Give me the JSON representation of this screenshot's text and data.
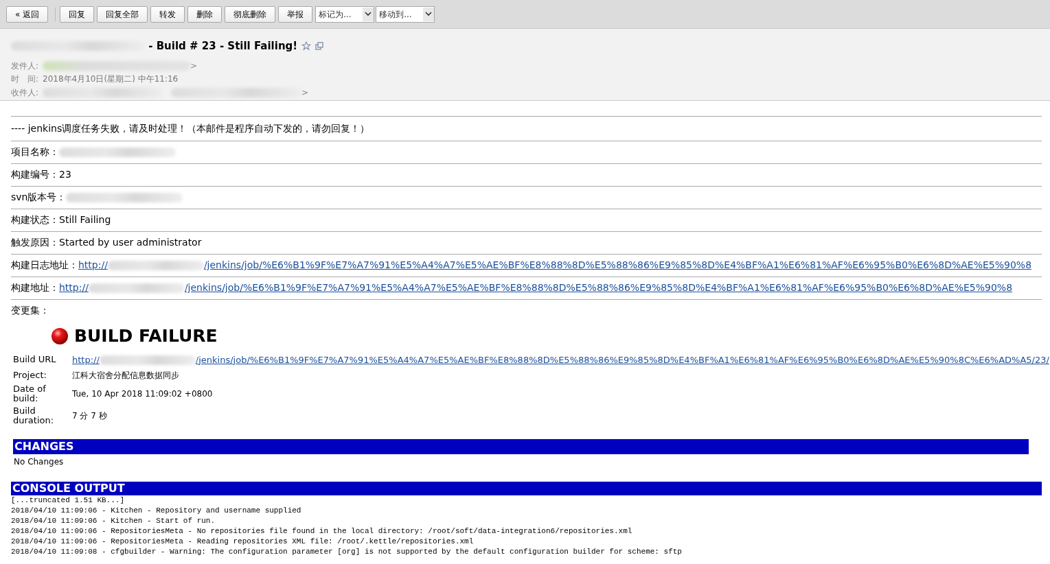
{
  "toolbar": [
    {
      "kind": "button",
      "label": "« 返回"
    },
    {
      "kind": "separator"
    },
    {
      "kind": "button",
      "label": "回复"
    },
    {
      "kind": "button",
      "label": "回复全部"
    },
    {
      "kind": "button",
      "label": "转发"
    },
    {
      "kind": "button",
      "label": "删除"
    },
    {
      "kind": "button",
      "label": "彻底删除"
    },
    {
      "kind": "button",
      "label": "举报"
    },
    {
      "kind": "select",
      "label": "标记为..."
    },
    {
      "kind": "select",
      "label": "移动到..."
    }
  ],
  "header": {
    "subject": " - Build # 23 - Still Failing!",
    "starred": false,
    "meta": [
      {
        "label": "发件人:",
        "kind": "redacted",
        "tail": ">"
      },
      {
        "label": "时　间:",
        "kind": "text",
        "value": "2018年4月10日(星期二) 中午11:16"
      },
      {
        "label": "收件人:",
        "kind": "redacted2",
        "tail": ">"
      }
    ]
  },
  "intro": "---- jenkins调度任务失败，请及时处理！（本邮件是程序自动下发的，请勿回复！）",
  "fields": [
    {
      "kind": "redacted",
      "label": "项目名称："
    },
    {
      "kind": "text",
      "label": "构建编号：",
      "value": "23"
    },
    {
      "kind": "redacted",
      "label": "svn版本号："
    },
    {
      "kind": "text",
      "label": "构建状态：",
      "value": "Still Failing"
    },
    {
      "kind": "text",
      "label": "触发原因：",
      "value": "Started by user administrator"
    },
    {
      "kind": "link",
      "label": "构建日志地址：",
      "prefix": "http://",
      "suffix": "/jenkins/job/%E6%B1%9F%E7%A7%91%E5%A4%A7%E5%AE%BF%E8%88%8D%E5%88%86%E9%85%8D%E4%BF%A1%E6%81%AF%E6%95%B0%E6%8D%AE%E5%90%8"
    },
    {
      "kind": "link",
      "label": "构建地址：",
      "prefix": "http://",
      "suffix": "/jenkins/job/%E6%B1%9F%E7%A7%91%E5%A4%A7%E5%AE%BF%E8%88%8D%E5%88%86%E9%85%8D%E4%BF%A1%E6%81%AF%E6%95%B0%E6%8D%AE%E5%90%8"
    },
    {
      "kind": "text",
      "label": "变更集："
    }
  ],
  "report": {
    "title": "BUILD FAILURE",
    "rows": [
      {
        "kind": "link",
        "label": "Build URL",
        "prefix": "http://",
        "suffix": "/jenkins/job/%E6%B1%9F%E7%A7%91%E5%A4%A7%E5%AE%BF%E8%88%8D%E5%88%86%E9%85%8D%E4%BF%A1%E6%81%AF%E6%95%B0%E6%8D%AE%E5%90%8C%E6%AD%A5/23/"
      },
      {
        "kind": "text",
        "label": "Project:",
        "value": "江科大宿舍分配信息数据同步"
      },
      {
        "kind": "text",
        "label": "Date of build:",
        "value": "Tue, 10 Apr 2018 11:09:02 +0800"
      },
      {
        "kind": "text",
        "label": "Build duration:",
        "value": "7 分 7 秒"
      }
    ]
  },
  "changes": {
    "title": "CHANGES",
    "text": "No Changes"
  },
  "console": {
    "title": "CONSOLE OUTPUT",
    "lines": [
      "[...truncated 1.51 KB...]",
      "2018/04/10 11:09:06 - Kitchen - Repository and username supplied",
      "2018/04/10 11:09:06 - Kitchen - Start of run.",
      "2018/04/10 11:09:06 - RepositoriesMeta - No repositories file found in the local directory: /root/soft/data-integration6/repositories.xml",
      "2018/04/10 11:09:06 - RepositoriesMeta - Reading repositories XML file: /root/.kettle/repositories.xml",
      "2018/04/10 11:09:08 - cfgbuilder - Warning: The configuration parameter [org] is not supported by the default configuration builder for scheme: sftp"
    ]
  }
}
